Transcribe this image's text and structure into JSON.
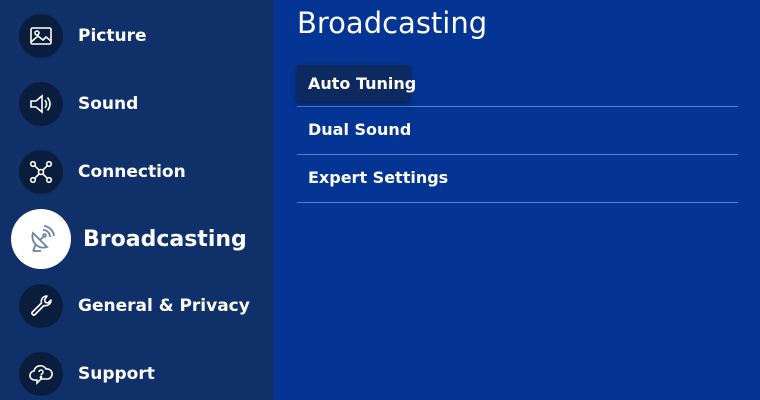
{
  "sidebar": {
    "items": [
      {
        "label": "Picture",
        "icon": "picture-icon"
      },
      {
        "label": "Sound",
        "icon": "speaker-icon"
      },
      {
        "label": "Connection",
        "icon": "connection-icon"
      },
      {
        "label": "Broadcasting",
        "icon": "satellite-dish-icon",
        "active": true
      },
      {
        "label": "General & Privacy",
        "icon": "wrench-icon"
      },
      {
        "label": "Support",
        "icon": "help-cloud-icon"
      }
    ]
  },
  "main": {
    "title": "Broadcasting",
    "options": [
      {
        "label": "Auto Tuning",
        "focused": true
      },
      {
        "label": "Dual Sound"
      },
      {
        "label": "Expert Settings"
      }
    ]
  },
  "colors": {
    "background": "#053594",
    "sidebar": "#0f3068",
    "icon_circle": "#0b1d3d",
    "active_circle": "#ffffff",
    "divider": "#5e7fc4"
  }
}
